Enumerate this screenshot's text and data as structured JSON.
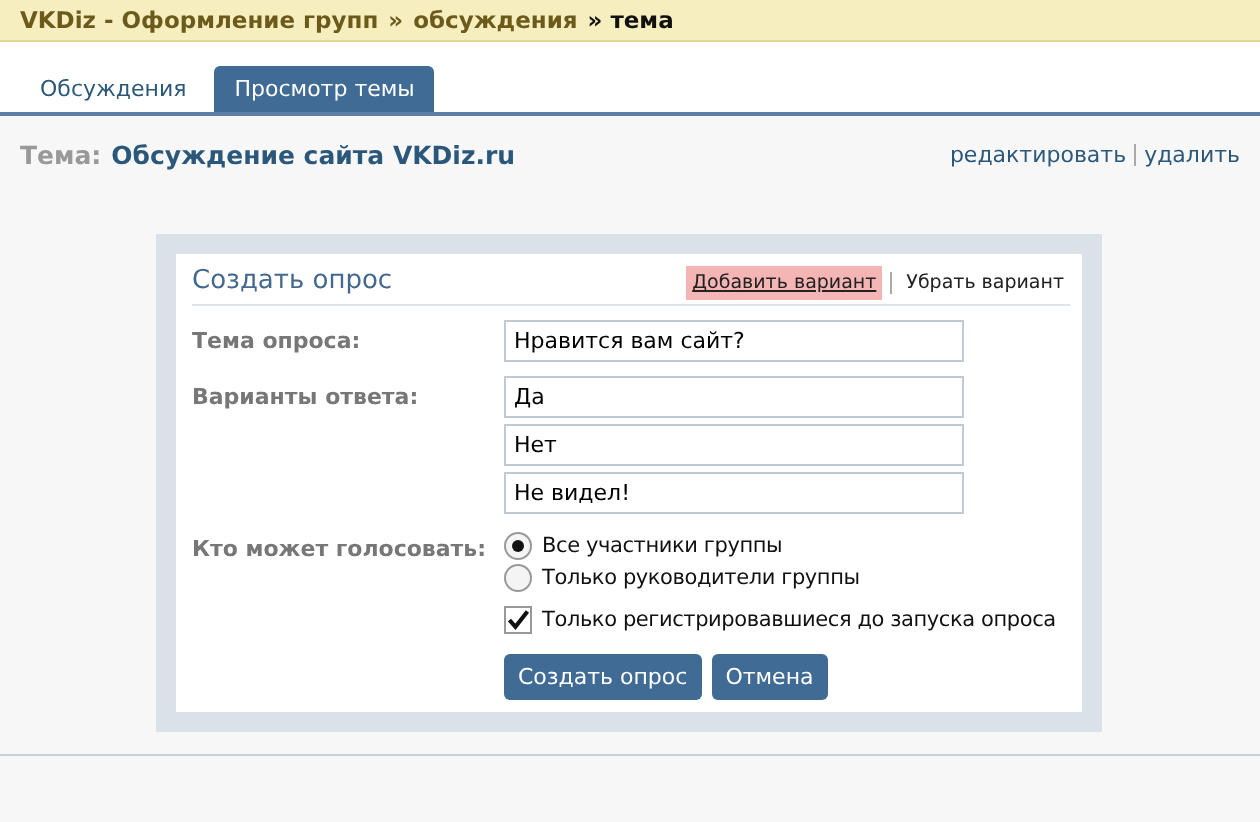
{
  "breadcrumb": [
    {
      "label": "VKDiz - Оформление групп",
      "kind": "link"
    },
    {
      "label": "»",
      "kind": "separator"
    },
    {
      "label": "обсуждения",
      "kind": "link"
    },
    {
      "label": "» тема",
      "kind": "current"
    }
  ],
  "tabs": [
    {
      "label": "Обсуждения",
      "selected": false
    },
    {
      "label": "Просмотр темы",
      "selected": true
    }
  ],
  "topic": {
    "prefix": "Тема:",
    "title": "Обсуждение сайта VKDiz.ru",
    "actions": [
      "редактировать",
      "удалить"
    ]
  },
  "dialog": {
    "title": "Создать опрос",
    "header_links": [
      {
        "label": "Добавить вариант",
        "highlighted": true
      },
      {
        "label": "Убрать вариант",
        "highlighted": false
      }
    ],
    "question_label": "Тема опроса:",
    "question": "Нравится вам сайт?",
    "answers_label": "Варианты ответа:",
    "answers": [
      "Да",
      "Нет",
      "Не видел!"
    ],
    "voters_label": "Кто может голосовать:",
    "voters": [
      {
        "label": "Все участники группы",
        "selected": true
      },
      {
        "label": "Только руководители группы",
        "selected": false
      }
    ],
    "registered_only": {
      "label": "Только регистрировавшиеся до запуска опроса",
      "checked": true
    },
    "buttons": [
      "Создать опрос",
      "Отмена"
    ]
  }
}
